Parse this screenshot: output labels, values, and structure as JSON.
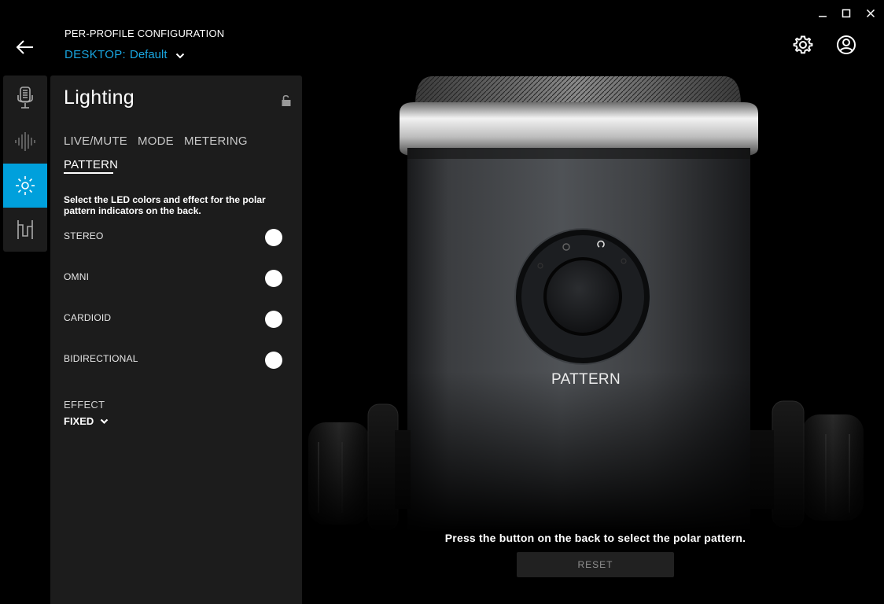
{
  "window": {
    "controls": [
      "minimize-icon",
      "maximize-icon",
      "close-icon"
    ]
  },
  "header": {
    "title": "PER-PROFILE CONFIGURATION",
    "profile_keyword": "DESKTOP:",
    "profile_name": "Default",
    "back_icon": "arrow-left-icon",
    "settings_icon": "gear-icon",
    "account_icon": "user-circle-icon"
  },
  "nav": {
    "items": [
      {
        "icon": "microphone-icon",
        "active": false
      },
      {
        "icon": "waveform-icon",
        "active": false
      },
      {
        "icon": "lighting-icon",
        "active": true
      },
      {
        "icon": "mixer-icon",
        "active": false
      }
    ]
  },
  "panel": {
    "title": "Lighting",
    "lock_icon": "unlock-icon",
    "tabs": [
      {
        "label": "LIVE/MUTE",
        "active": false
      },
      {
        "label": "MODE",
        "active": false
      },
      {
        "label": "METERING",
        "active": false
      },
      {
        "label": "PATTERN",
        "active": true
      }
    ],
    "description": "Select the LED colors and effect for the polar pattern indicators on the back.",
    "patterns": [
      {
        "label": "STEREO",
        "color": "#ffffff"
      },
      {
        "label": "OMNI",
        "color": "#ffffff"
      },
      {
        "label": "CARDIOID",
        "color": "#ffffff"
      },
      {
        "label": "BIDIRECTIONAL",
        "color": "#ffffff"
      }
    ],
    "effect_label": "EFFECT",
    "effect_value": "FIXED"
  },
  "device": {
    "button_label": "PATTERN",
    "hint": "Press the button on the back to select the polar pattern.",
    "reset_label": "RESET"
  },
  "colors": {
    "accent": "#00a0dc",
    "profile_link": "#19a6e0",
    "panel_bg": "#1c1c1c"
  }
}
